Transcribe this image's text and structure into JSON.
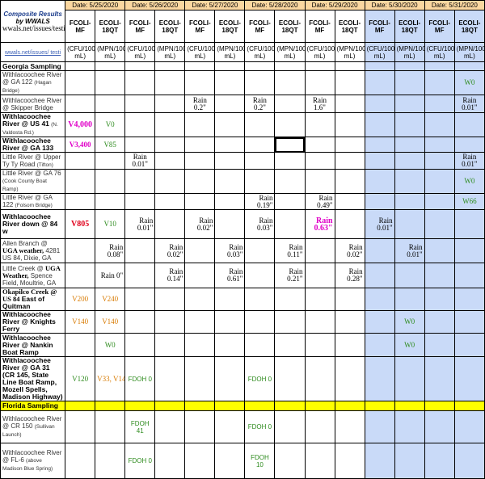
{
  "header": {
    "title": "Composite Results",
    "by": "by WWALS",
    "url": "wwals.net/issues/testing/",
    "url_short": "wwals.net/issues/ testi"
  },
  "dates": [
    "Date: 5/25/2020",
    "Date: 5/26/2020",
    "Date: 5/27/2020",
    "Date: 5/28/2020",
    "Date: 5/29/2020",
    "Date: 5/30/2020",
    "Date: 5/31/2020"
  ],
  "cols": {
    "fcoli": "FCOLI-MF",
    "ecoli": "ECOLI-18QT",
    "fcoli_unit": "(CFU/100 mL)",
    "ecoli_unit": "(MPN/100 mL)"
  },
  "sections": {
    "georgia": "Georgia Sampling",
    "florida": "Florida Sampling"
  },
  "sites": {
    "s1a": "Withlacoochee River @ GA 122",
    "s1b": "(Hagan Bridge)",
    "s2": "Withlacoochee River @ Skipper Bridge",
    "s3a": "Withlacoochee River @ US 41",
    "s3b": "(N. Valdosta Rd.)",
    "s4": "Withlacoochee River @ GA 133",
    "s5a": "Little River @ Upper Ty Ty Road",
    "s5b": "(Tifton)",
    "s6a": "Little River @ GA 76",
    "s6b": "(Cook County Boat Ramp)",
    "s7a": "Little River @ GA 122",
    "s7b": "(Folsom Bridge)",
    "s8": "Withlacoochee River down @ 84 w",
    "s9a": "Allen Branch @",
    "s9b": "UGA weather,",
    "s9c": "4281 US 84, Dixie, GA",
    "s10a": "Little Creek @",
    "s10b": "UGA Weather,",
    "s10c": "Spence Field, Moultrie, GA",
    "s11a": "Okapilco Creek @ US 84",
    "s11b": "East of Quitman",
    "s12": "Withlacoochee River @ Knights Ferry",
    "s13": "Withlacoochee River @ Nankin Boat Ramp",
    "s14a": "Withlacoochee River @ GA 31",
    "s14b": "(CR 145, State Line Boat Ramp, Mozell Spells, Madison Highway)",
    "f1a": "Withlacoochee River @ CR 150",
    "f1b": "(Sullivan Launch)",
    "f2a": "Withlacoochee River @ FL-6",
    "f2b": "(above Madison Blue Spring)"
  },
  "values": {
    "w0": "W0",
    "rain_02": "Rain 0.2\"",
    "rain_16": "Rain 1.6\"",
    "rain_001": "Rain 0.01\"",
    "v4000": "V4,000",
    "v0": "V0",
    "v3400": "V3,400",
    "v85": "V85",
    "rain_019": "Rain 0.19\"",
    "rain_049": "Rain 0.49\"",
    "w66": "W66",
    "v805": "V805",
    "v10": "V10",
    "rain_002": "Rain 0.02\"",
    "rain_003": "Rain 0.03\"",
    "rain_063": "Rain 0.63\"",
    "rain_008": "Rain 0.08\"",
    "rain_011": "Rain 0.11\"",
    "rain_0": "Rain 0\"",
    "rain_014": "Rain 0.14\"",
    "rain_061": "Rain 0.61\"",
    "rain_021": "Rain 0.21\"",
    "rain_028": "Rain 0.28\"",
    "v200": "V200",
    "v240": "V240",
    "v140": "V140",
    "v120": "V120",
    "v33_140": "V33, V140",
    "fdoh0": "FDOH 0",
    "fdoh41": "FDOH 41",
    "fdoh10": "FDOH 10"
  },
  "colors": {
    "date_bg": "#fad7a0",
    "blue_bg": "#c9daf8",
    "section_yellow": "#ffff00",
    "red": "#e0001b",
    "green": "#2e8b1e",
    "orange": "#d87a00",
    "magenta": "#e000c8"
  }
}
